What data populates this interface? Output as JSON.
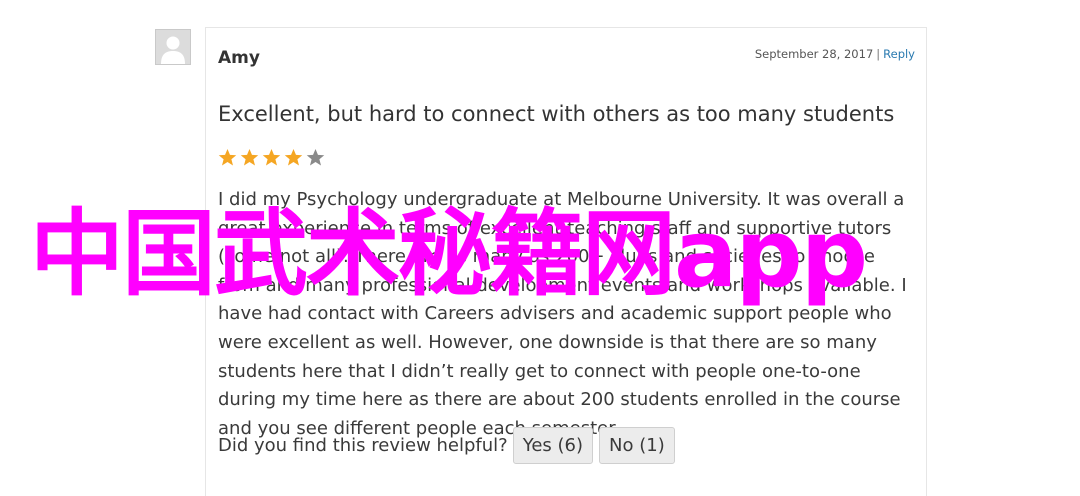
{
  "review": {
    "author": "Amy",
    "date": "September 28, 2017",
    "separator": "|",
    "reply_label": "Reply",
    "title": "Excellent, but hard to connect with others as too many students",
    "rating": 4,
    "rating_max": 5,
    "star_filled_color": "#f5a623",
    "star_empty_color": "#8a8a8a",
    "body": "I did my Psychology undergraduate at Melbourne University. It was overall a great experience in terms of excellent teaching staff and supportive tutors (some not all). There are as many as 200+ clubs and societies to choose from and many professional development events and workshops available. I have had contact with Careers advisers and academic support people who were excellent as well. However, one downside is that there are so many students here that I didn’t really get to connect with people one-to-one during my time here as there are about 200 students enrolled in the course and you see different people each semester.",
    "helpful_question": "Did you find this review helpful?",
    "vote_yes_label": "Yes (6)",
    "vote_no_label": "No (1)"
  },
  "watermark": {
    "text": "中国武术秘籍网app",
    "color": "#ff00ff"
  }
}
